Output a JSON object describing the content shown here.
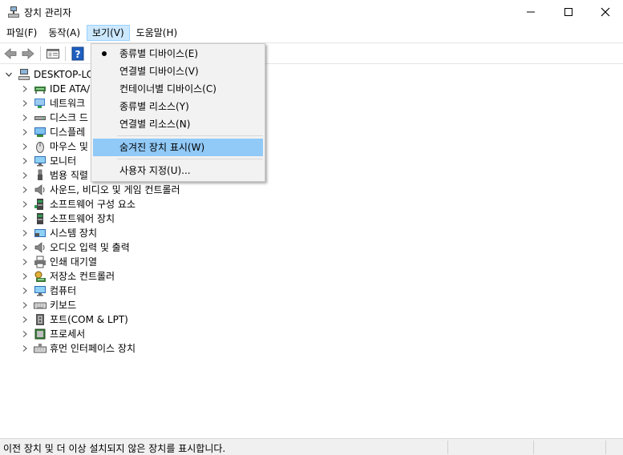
{
  "window": {
    "title": "장치 관리자",
    "minimize_icon": "minimize-icon",
    "maximize_icon": "maximize-icon",
    "close_icon": "close-icon"
  },
  "menubar": {
    "items": [
      {
        "label": "파일(F)"
      },
      {
        "label": "동작(A)"
      },
      {
        "label": "보기(V)",
        "active": true
      },
      {
        "label": "도움말(H)"
      }
    ]
  },
  "toolbar": {
    "icons": [
      "back-arrow-icon",
      "forward-arrow-icon",
      "properties-icon",
      "help-icon"
    ]
  },
  "tree": {
    "root": "DESKTOP-LO",
    "nodes": [
      {
        "label": "IDE ATA/",
        "icon": "ide-controller-icon"
      },
      {
        "label": "네트워크",
        "icon": "network-adapter-icon"
      },
      {
        "label": "디스크 드",
        "icon": "disk-drive-icon"
      },
      {
        "label": "디스플레",
        "icon": "display-adapter-icon"
      },
      {
        "label": "마우스 및",
        "icon": "mouse-icon"
      },
      {
        "label": "모니터",
        "icon": "monitor-icon"
      },
      {
        "label": "범용 직렬",
        "icon": "usb-icon"
      },
      {
        "label": "사운드, 비디오 및 게임 컨트롤러",
        "icon": "speaker-icon"
      },
      {
        "label": "소프트웨어 구성 요소",
        "icon": "software-component-icon"
      },
      {
        "label": "소프트웨어 장치",
        "icon": "software-device-icon"
      },
      {
        "label": "시스템 장치",
        "icon": "system-device-icon"
      },
      {
        "label": "오디오 입력 및 출력",
        "icon": "audio-io-icon"
      },
      {
        "label": "인쇄 대기열",
        "icon": "printer-icon"
      },
      {
        "label": "저장소 컨트롤러",
        "icon": "storage-controller-icon"
      },
      {
        "label": "컴퓨터",
        "icon": "computer-icon"
      },
      {
        "label": "키보드",
        "icon": "keyboard-icon"
      },
      {
        "label": "포트(COM & LPT)",
        "icon": "port-icon"
      },
      {
        "label": "프로세서",
        "icon": "processor-icon"
      },
      {
        "label": "휴먼 인터페이스 장치",
        "icon": "hid-icon"
      }
    ]
  },
  "view_menu": {
    "items": [
      {
        "label": "종류별 디바이스(E)",
        "checked": true
      },
      {
        "label": "연결별 디바이스(V)"
      },
      {
        "label": "컨테이너별 디바이스(C)"
      },
      {
        "label": "종류별 리소스(Y)"
      },
      {
        "label": "연결별 리소스(N)"
      },
      {
        "label": "숨겨진 장치 표시(W)",
        "highlighted": true
      },
      {
        "label": "사용자 지정(U)..."
      }
    ]
  },
  "statusbar": {
    "text": "이전 장치 및 더 이상 설치되지 않은 장치를 표시합니다."
  },
  "colors": {
    "menu_active_bg": "#cce8ff",
    "menu_highlight_bg": "#91c9f7",
    "dropdown_bg": "#f2f2f2",
    "statusbar_bg": "#f0f0f0"
  }
}
